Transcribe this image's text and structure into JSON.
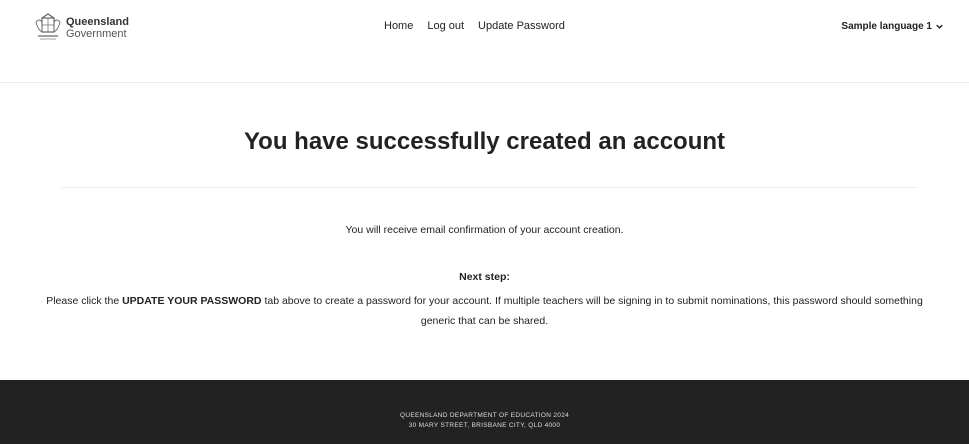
{
  "header": {
    "logo": {
      "line1": "Queensland",
      "line2": "Government"
    },
    "nav": [
      "Home",
      "Log out",
      "Update Password"
    ],
    "language": "Sample language 1"
  },
  "main": {
    "title": "You have successfully created an account",
    "confirmation": "You will receive email confirmation of your account creation.",
    "next_step_label": "Next step:",
    "instruction_prefix": "Please click the",
    "instruction_highlight": "UPDATE YOUR PASSWORD",
    "instruction_suffix": "tab above to create a password for your account. If multiple teachers will be signing in to submit nominations, this password should something generic that can be shared."
  },
  "footer": {
    "line1": "QUEENSLAND DEPARTMENT OF EDUCATION 2024",
    "line2": "30 MARY STREET, BRISBANE CITY, QLD 4000"
  }
}
